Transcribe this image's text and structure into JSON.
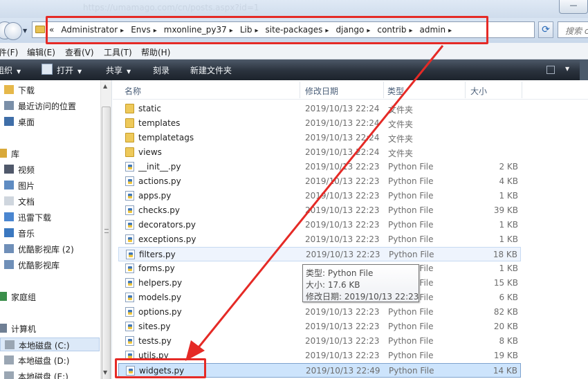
{
  "titlebar": {
    "url_text": "https://umamago.com/cn/posts.aspx?id=1",
    "minimize": "—"
  },
  "address": {
    "crumbs": [
      "«",
      "Administrator",
      "Envs",
      "mxonline_py37",
      "Lib",
      "site-packages",
      "django",
      "contrib",
      "admin"
    ],
    "search_placeholder": "搜索 c"
  },
  "menu": [
    "件(F)",
    "编辑(E)",
    "查看(V)",
    "工具(T)",
    "帮助(H)"
  ],
  "toolbar": {
    "organize": "组织",
    "open": "打开",
    "share": "共享",
    "burn": "刻录",
    "new_folder": "新建文件夹"
  },
  "nav": [
    {
      "label": "下载",
      "icon": "download-folder-icon"
    },
    {
      "label": "最近访问的位置",
      "icon": "recent-places-icon"
    },
    {
      "label": "桌面",
      "icon": "desktop-icon"
    },
    {
      "label": "库",
      "icon": "library-icon"
    },
    {
      "label": "视频",
      "icon": "video-icon"
    },
    {
      "label": "图片",
      "icon": "picture-icon"
    },
    {
      "label": "文档",
      "icon": "document-icon"
    },
    {
      "label": "迅雷下载",
      "icon": "thunder-download-icon"
    },
    {
      "label": "音乐",
      "icon": "music-icon"
    },
    {
      "label": "优酷影视库 (2)",
      "icon": "youku-library-icon"
    },
    {
      "label": "优酷影视库",
      "icon": "youku-library-icon"
    },
    {
      "label": "家庭组",
      "icon": "homegroup-icon"
    },
    {
      "label": "计算机",
      "icon": "computer-icon"
    },
    {
      "label": "本地磁盘 (C:)",
      "icon": "drive-icon"
    },
    {
      "label": "本地磁盘 (D:)",
      "icon": "drive-icon"
    },
    {
      "label": "本地磁盘 (E:)",
      "icon": "drive-icon"
    }
  ],
  "columns": {
    "name": "名称",
    "date": "修改日期",
    "type": "类型",
    "size": "大小"
  },
  "files": [
    {
      "name": "static",
      "date": "2019/10/13 22:24",
      "type": "文件夹",
      "size": "",
      "kind": "folder"
    },
    {
      "name": "templates",
      "date": "2019/10/13 22:24",
      "type": "文件夹",
      "size": "",
      "kind": "folder"
    },
    {
      "name": "templatetags",
      "date": "2019/10/13 22:24",
      "type": "文件夹",
      "size": "",
      "kind": "folder"
    },
    {
      "name": "views",
      "date": "2019/10/13 22:24",
      "type": "文件夹",
      "size": "",
      "kind": "folder"
    },
    {
      "name": "__init__.py",
      "date": "2019/10/13 22:23",
      "type": "Python File",
      "size": "2 KB",
      "kind": "py"
    },
    {
      "name": "actions.py",
      "date": "2019/10/13 22:23",
      "type": "Python File",
      "size": "4 KB",
      "kind": "py"
    },
    {
      "name": "apps.py",
      "date": "2019/10/13 22:23",
      "type": "Python File",
      "size": "1 KB",
      "kind": "py"
    },
    {
      "name": "checks.py",
      "date": "2019/10/13 22:23",
      "type": "Python File",
      "size": "39 KB",
      "kind": "py"
    },
    {
      "name": "decorators.py",
      "date": "2019/10/13 22:23",
      "type": "Python File",
      "size": "1 KB",
      "kind": "py"
    },
    {
      "name": "exceptions.py",
      "date": "2019/10/13 22:23",
      "type": "Python File",
      "size": "1 KB",
      "kind": "py"
    },
    {
      "name": "filters.py",
      "date": "2019/10/13 22:23",
      "type": "Python File",
      "size": "18 KB",
      "kind": "py"
    },
    {
      "name": "forms.py",
      "date": "2019/10/13 22:23",
      "type": "Python File",
      "size": "1 KB",
      "kind": "py"
    },
    {
      "name": "helpers.py",
      "date": "2019/10/13 22:23",
      "type": "Python File",
      "size": "15 KB",
      "kind": "py"
    },
    {
      "name": "models.py",
      "date": "2019/10/13 22:23",
      "type": "Python File",
      "size": "6 KB",
      "kind": "py"
    },
    {
      "name": "options.py",
      "date": "2019/10/13 22:23",
      "type": "Python File",
      "size": "82 KB",
      "kind": "py"
    },
    {
      "name": "sites.py",
      "date": "2019/10/13 22:23",
      "type": "Python File",
      "size": "20 KB",
      "kind": "py"
    },
    {
      "name": "tests.py",
      "date": "2019/10/13 22:23",
      "type": "Python File",
      "size": "8 KB",
      "kind": "py"
    },
    {
      "name": "utils.py",
      "date": "2019/10/13 22:23",
      "type": "Python File",
      "size": "19 KB",
      "kind": "py"
    },
    {
      "name": "widgets.py",
      "date": "2019/10/13 22:49",
      "type": "Python File",
      "size": "14 KB",
      "kind": "py"
    }
  ],
  "tooltip": {
    "type": "类型: Python File",
    "size": "大小: 17.6 KB",
    "modified": "修改日期: 2019/10/13 22:23"
  },
  "colors": {
    "annotation": "#e52a26",
    "toolbar": "#2a323d",
    "selection": "#cde4fc"
  }
}
